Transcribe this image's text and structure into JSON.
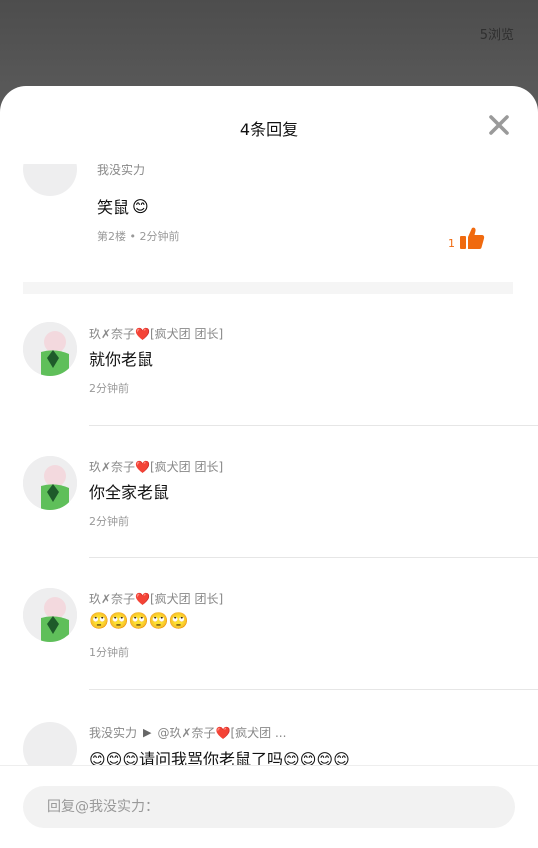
{
  "header": {
    "views": "5浏览"
  },
  "sheet": {
    "title": "4条回复",
    "close_icon": "close-icon"
  },
  "main_comment": {
    "author": "我没实力",
    "text": "笑鼠",
    "emoji": "😊",
    "meta": "第2楼 • 2分钟前",
    "like_count": "1",
    "like_icon": "thumbs-up-icon",
    "like_color": "#f06a0f"
  },
  "replies": [
    {
      "author": "玖✗奈子❤️[疯犬团 团长]",
      "text": "就你老鼠",
      "time": "2分钟前"
    },
    {
      "author": "玖✗奈子❤️[疯犬团 团长]",
      "text": "你全家老鼠",
      "time": "2分钟前"
    },
    {
      "author": "玖✗奈子❤️[疯犬团 团长]",
      "text": "🙄🙄🙄🙄🙄",
      "time": "1分钟前"
    },
    {
      "author": "我没实力",
      "reply_to": "@玖✗奈子❤️[疯犬团 ...",
      "text": "😊😊😊请问我骂你老鼠了吗😊😊😊😊"
    }
  ],
  "footer": {
    "placeholder": "回复@我没实力："
  }
}
